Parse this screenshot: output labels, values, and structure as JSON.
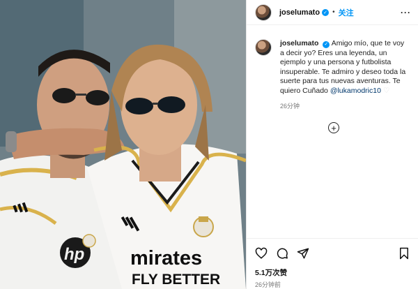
{
  "post": {
    "username": "joselumato",
    "verified_mark": "✓",
    "separator": "•",
    "follow_label": "关注",
    "more_label": "···"
  },
  "caption": {
    "username": "joselumato",
    "text": "Amigo mío, que te voy a decir yo? Eres una leyenda, un ejemplo y una persona y futbolista insuperable. Te admiro y deseo toda la suerte para tus nuevas aventuras. Te quiero Cuñado ",
    "mention": "@lukamodric10",
    "heart": "♡",
    "time": "26分钟"
  },
  "add_comment_label": "+",
  "stats": {
    "likes": "5.1万次赞",
    "time": "26分钟前"
  },
  "photo": {
    "shirt_sponsor_1": "mirates",
    "shirt_sponsor_2": "FLY BETTER",
    "left_sponsor": "hp"
  },
  "icons": [
    "heart-icon",
    "comment-icon",
    "share-icon",
    "bookmark-icon",
    "plus-circle-icon",
    "more-icon",
    "verified-icon"
  ]
}
